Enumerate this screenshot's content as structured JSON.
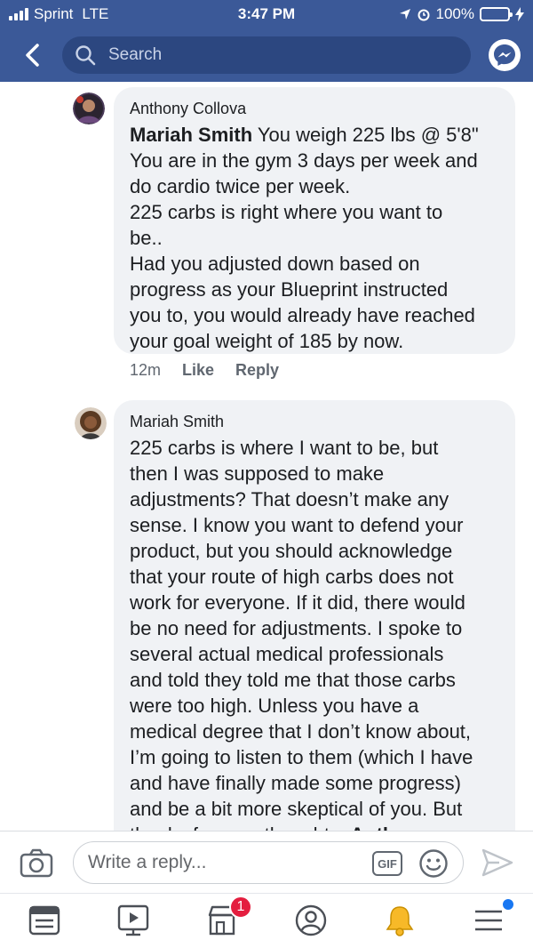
{
  "status_bar": {
    "carrier": "Sprint",
    "network": "LTE",
    "time": "3:47 PM",
    "battery": "100%",
    "battery_level": 1.0
  },
  "nav": {
    "search_placeholder": "Search",
    "icons": [
      "back-icon",
      "search-icon",
      "messenger-icon"
    ]
  },
  "comments": [
    {
      "author": "Anthony Collova",
      "mention": "Mariah Smith",
      "text_lines": [
        " You weigh 225 lbs @ 5'8\"",
        "You are in the gym 3 days per week and",
        "do cardio twice per week.",
        "225 carbs is right where you want to",
        "be..",
        "Had you adjusted down based on",
        "progress as your Blueprint instructed",
        "you to, you would already have reached",
        "your goal weight of 185 by now."
      ],
      "time": "12m",
      "like_label": "Like",
      "reply_label": "Reply"
    },
    {
      "author": "Mariah Smith",
      "text_lines": [
        "225 carbs is where I want to be, but",
        "then I was supposed to make",
        "adjustments? That doesn’t make any",
        "sense. I know you want to defend your",
        "product, but you should acknowledge",
        "that your route of high carbs does not",
        "work for everyone. If it did, there would",
        "be no need for adjustments. I spoke to",
        "several actual medical professionals",
        "and told they told me that those carbs",
        "were too high. Unless you have a",
        "medical degree that I don’t know about,",
        "I’m going to listen to them (which I have",
        "and have finally made some progress)",
        "and be a bit more skeptical of you. But"
      ],
      "last_line_text": "thanks for your thoughts. ",
      "last_line_mention": "Anthony"
    }
  ],
  "reply_bar": {
    "placeholder": "Write a reply...",
    "gif_label": "GIF"
  },
  "tab_bar": {
    "tabs": [
      "news-feed-icon",
      "watch-icon",
      "marketplace-icon",
      "profile-icon",
      "notifications-icon",
      "menu-icon"
    ],
    "marketplace_badge": "1",
    "colors": {
      "brand": "#3b5998",
      "bell": "#f7b928",
      "badge": "#e41e3f"
    }
  }
}
